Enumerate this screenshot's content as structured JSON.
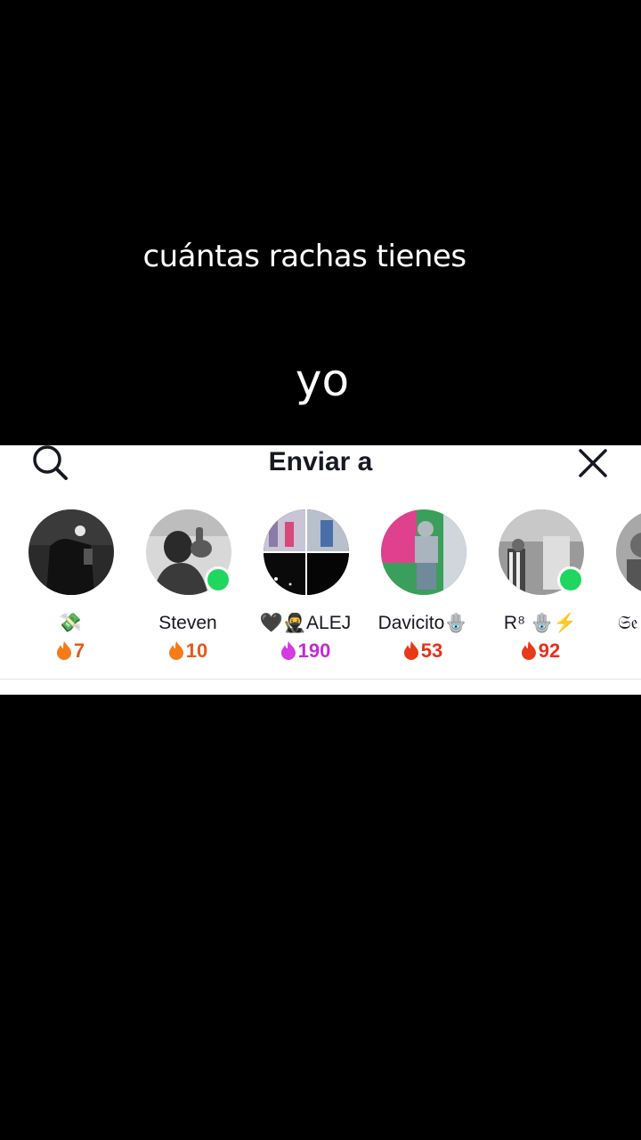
{
  "caption": {
    "question": "cuántas rachas tienes",
    "answer": "yo"
  },
  "share_sheet": {
    "title": "Enviar a",
    "search_icon": "search-icon",
    "close_icon": "close-icon",
    "contacts": [
      {
        "name": "💸",
        "streak": "7",
        "online": false,
        "streak_color": "#e8591a"
      },
      {
        "name": "Steven",
        "streak": "10",
        "online": true,
        "streak_color": "#e8591a"
      },
      {
        "name": "🖤🥷ALEJ",
        "streak": "190",
        "online": false,
        "streak_color": "#c12bd4"
      },
      {
        "name": "Davicito🪬",
        "streak": "53",
        "online": false,
        "streak_color": "#e8301a"
      },
      {
        "name": "R⁸ 🪬⚡",
        "streak": "92",
        "online": true,
        "streak_color": "#e8301a"
      },
      {
        "name": "𝔖𝔢",
        "streak": "",
        "online": false,
        "streak_color": "#e8591a"
      }
    ]
  }
}
